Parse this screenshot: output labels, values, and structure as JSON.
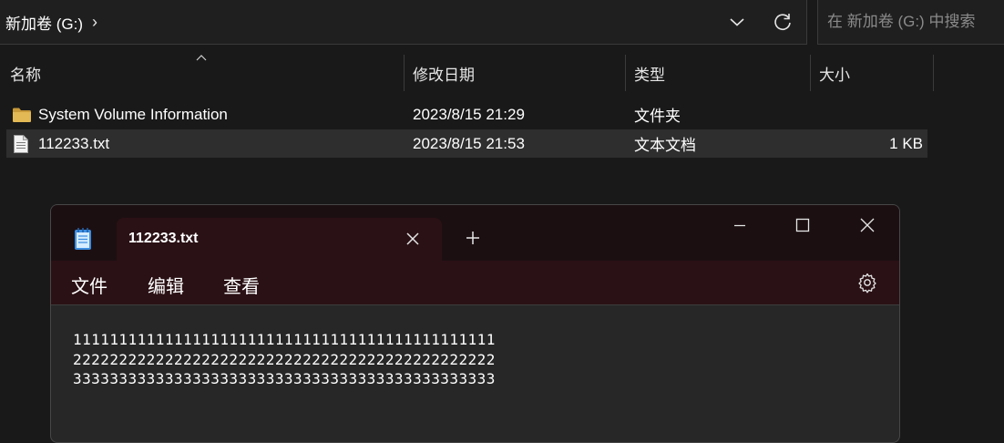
{
  "address_bar": {
    "location": "新加卷 (G:)",
    "separator": "›",
    "dropdown_icon": "chevron-down-icon",
    "refresh_icon": "refresh-icon"
  },
  "search": {
    "placeholder": "在 新加卷 (G:) 中搜索"
  },
  "columns": {
    "name": "名称",
    "date": "修改日期",
    "type": "类型",
    "size": "大小"
  },
  "files": [
    {
      "name": "System Volume Information",
      "date": "2023/8/15 21:29",
      "type": "文件夹",
      "size": "",
      "icon": "folder-icon",
      "selected": false
    },
    {
      "name": "112233.txt",
      "date": "2023/8/15 21:53",
      "type": "文本文档",
      "size": "1 KB",
      "icon": "text-file-icon",
      "selected": true
    }
  ],
  "notepad": {
    "tab_title": "112233.txt",
    "menu": [
      "文件",
      "编辑",
      "查看"
    ],
    "content": [
      "1111111111111111111111111111111111111111111111",
      "2222222222222222222222222222222222222222222222",
      "3333333333333333333333333333333333333333333333"
    ]
  },
  "colors": {
    "background": "#191919",
    "notepad_titlebar": "#1c0f12",
    "notepad_tab": "#2a1115",
    "folder": "#d9b35a"
  }
}
